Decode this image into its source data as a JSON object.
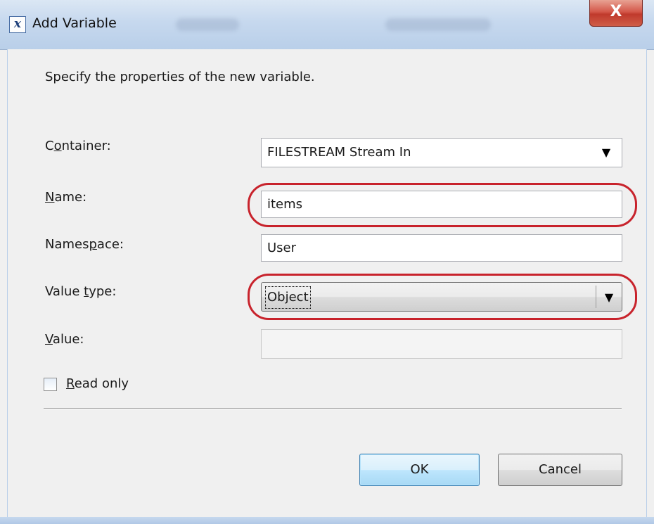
{
  "window": {
    "title": "Add Variable",
    "icon": "variable-x-icon",
    "close_glyph": "X"
  },
  "description": "Specify the properties of the new variable.",
  "form": {
    "container": {
      "label_pre": "C",
      "label_key": "o",
      "label_post": "ntainer:",
      "value": "FILESTREAM Stream In"
    },
    "name": {
      "label_pre": "",
      "label_key": "N",
      "label_post": "ame:",
      "value": "items"
    },
    "namespace": {
      "label_pre": "Names",
      "label_key": "p",
      "label_post": "ace:",
      "value": "User"
    },
    "value_type": {
      "label_pre": "Value ",
      "label_key": "t",
      "label_post": "ype:",
      "value": "Object"
    },
    "value": {
      "label_pre": "",
      "label_key": "V",
      "label_post": "alue:",
      "value": ""
    },
    "read_only": {
      "label_pre": "",
      "label_key": "R",
      "label_post": "ead only",
      "checked": false
    }
  },
  "buttons": {
    "ok": "OK",
    "cancel": "Cancel"
  },
  "colors": {
    "highlight": "#c8232c",
    "titlebar": "#c6d8ee",
    "close": "#c03a2c"
  }
}
